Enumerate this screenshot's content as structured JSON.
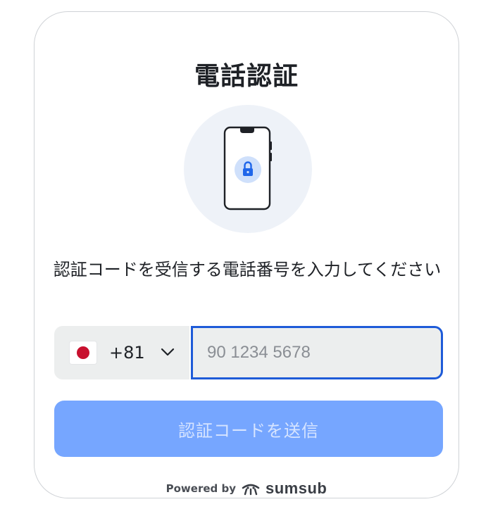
{
  "title": "電話認証",
  "description": "認証コードを受信する電話番号を入力してください",
  "phone": {
    "country_flag": "jp-flag-icon",
    "dial_code": "+81",
    "placeholder": "90 1234 5678",
    "value": ""
  },
  "send_button_label": "認証コードを送信",
  "footer": {
    "powered_by": "Powered by",
    "brand": "sumsub"
  },
  "colors": {
    "accent": "#1e5bd8",
    "button_disabled": "#76a6ff",
    "lock_badge": "#1f66ea",
    "hero_bg": "#eef2f8"
  }
}
